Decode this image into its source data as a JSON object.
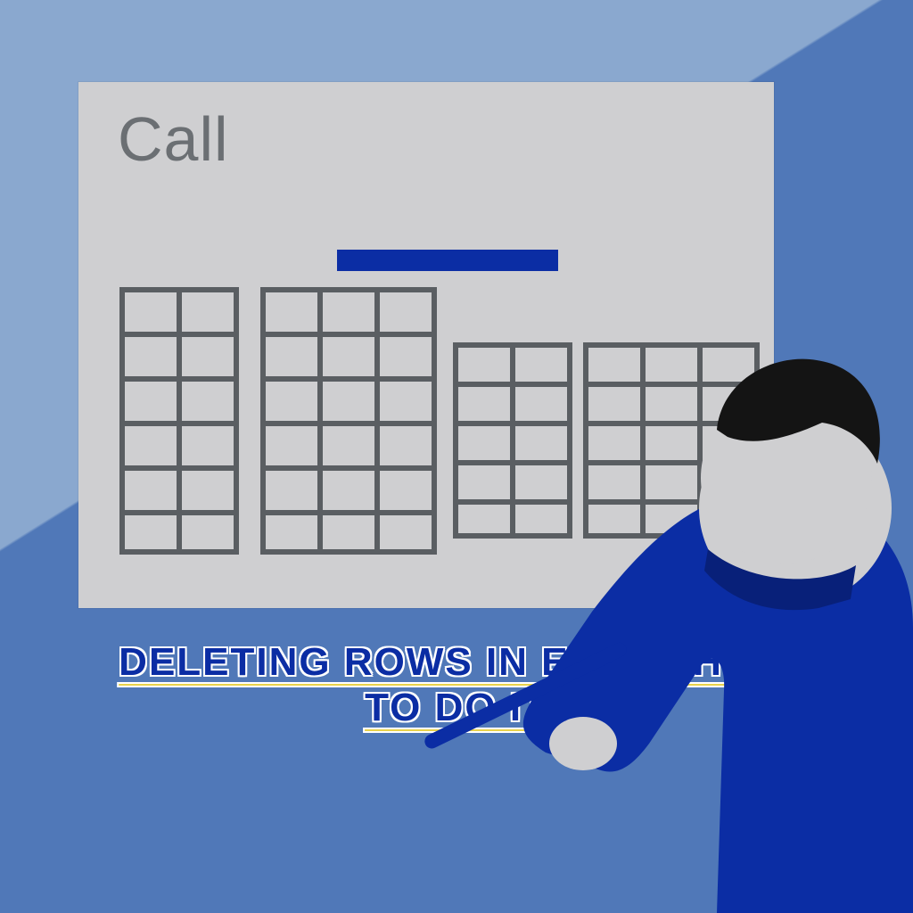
{
  "panel": {
    "title": "Call"
  },
  "headline": {
    "line1": "DELETING ROWS IN EXCEL HOW",
    "line2": "TO DO IT"
  }
}
